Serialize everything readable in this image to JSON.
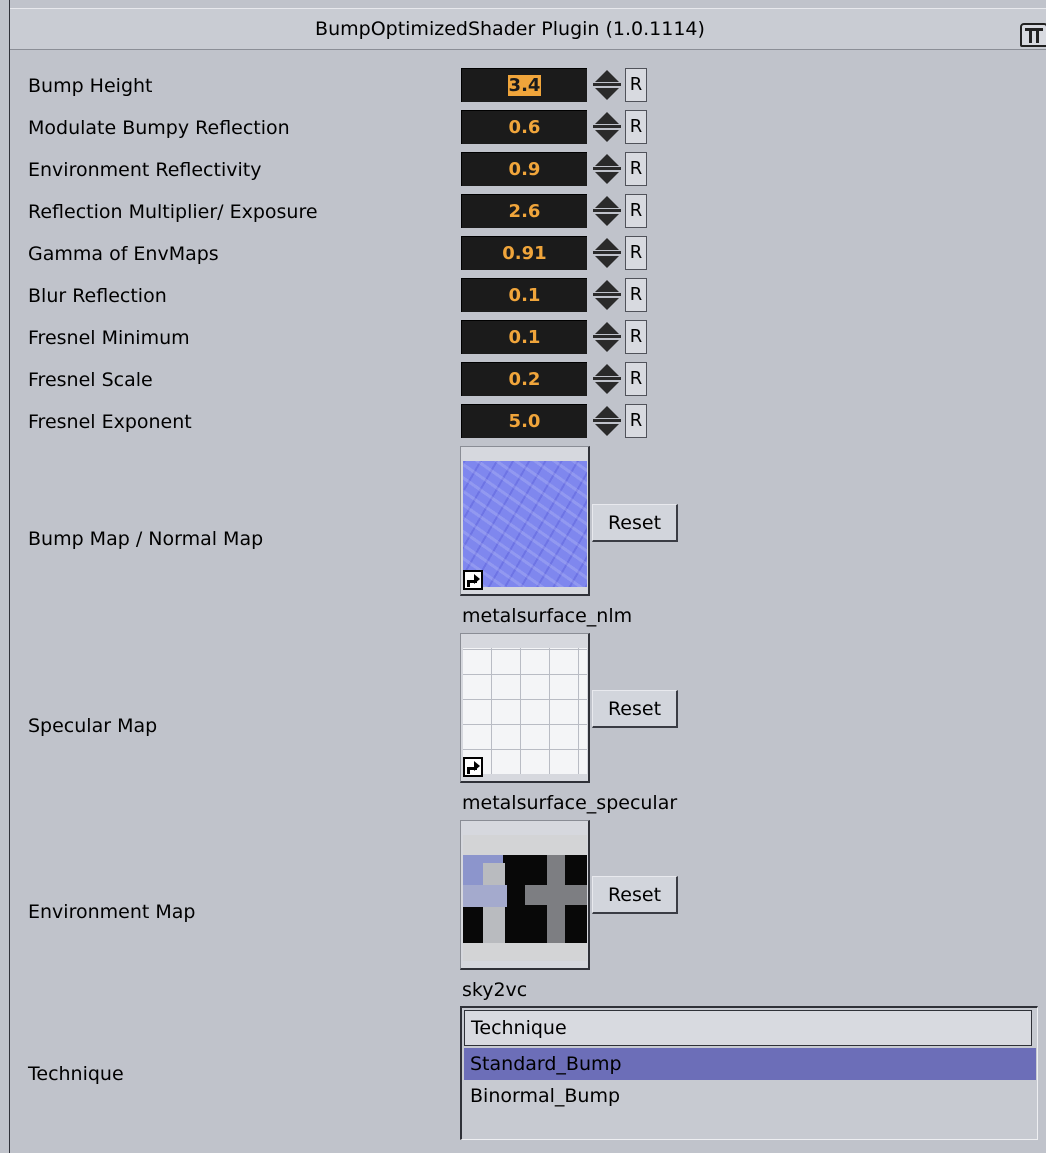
{
  "window": {
    "title": "BumpOptimizedShader Plugin (1.0.1114)",
    "logo_icon": "plugin-logo-icon"
  },
  "colors": {
    "panel_bg": "#c0c3cb",
    "field_bg": "#1b1b1b",
    "field_text": "#f0a53b",
    "selection": "#6c6eb8"
  },
  "parameters": [
    {
      "label": "Bump Height",
      "value": "3.4"
    },
    {
      "label": "Modulate Bumpy Reflection",
      "value": "0.6"
    },
    {
      "label": "Environment Reflectivity",
      "value": "0.9"
    },
    {
      "label": "Reflection Multiplier/ Exposure",
      "value": "2.6"
    },
    {
      "label": "Gamma of EnvMaps",
      "value": "0.91"
    },
    {
      "label": "Blur Reflection",
      "value": "0.1"
    },
    {
      "label": "Fresnel Minimum",
      "value": "0.1"
    },
    {
      "label": "Fresnel Scale",
      "value": "0.2"
    },
    {
      "label": "Fresnel Exponent",
      "value": "5.0"
    }
  ],
  "reset_short_label": "R",
  "maps": [
    {
      "label": "Bump Map / Normal Map",
      "filename": "metalsurface_nlm",
      "reset_label": "Reset"
    },
    {
      "label": "Specular Map",
      "filename": "metalsurface_specular",
      "reset_label": "Reset"
    },
    {
      "label": "Environment Map",
      "filename": "sky2vc",
      "reset_label": "Reset"
    }
  ],
  "technique": {
    "label": "Technique",
    "header": "Technique",
    "options": [
      "Standard_Bump",
      "Binormal_Bump"
    ],
    "selected": "Standard_Bump"
  }
}
